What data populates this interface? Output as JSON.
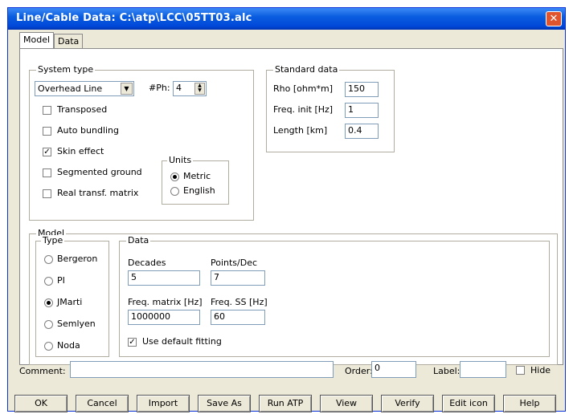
{
  "window": {
    "title": "Line/Cable Data: C:\\atp\\LCC\\05TT03.alc",
    "close_glyph": "✕"
  },
  "tabs": [
    {
      "label": "Model"
    },
    {
      "label": "Data"
    }
  ],
  "system_type": {
    "group_label": "System type",
    "type_value": "Overhead Line",
    "ph_label": "#Ph:",
    "ph_value": "4",
    "transposed_label": "Transposed",
    "transposed_checked": false,
    "auto_bundling_label": "Auto bundling",
    "auto_bundling_checked": false,
    "skin_effect_label": "Skin effect",
    "skin_effect_checked": true,
    "segmented_ground_label": "Segmented ground",
    "segmented_ground_checked": false,
    "real_transf_label": "Real transf. matrix",
    "real_transf_checked": false,
    "units": {
      "group_label": "Units",
      "metric_label": "Metric",
      "english_label": "English",
      "selected": "Metric"
    }
  },
  "standard_data": {
    "group_label": "Standard data",
    "rho_label": "Rho [ohm*m]",
    "rho_value": "150",
    "freq_init_label": "Freq. init [Hz]",
    "freq_init_value": "1",
    "length_label": "Length [km]",
    "length_value": "0.4"
  },
  "model": {
    "group_label": "Model",
    "type_group_label": "Type",
    "types": [
      "Bergeron",
      "PI",
      "JMarti",
      "Semlyen",
      "Noda"
    ],
    "selected_type": "JMarti",
    "data_group_label": "Data",
    "decades_label": "Decades",
    "decades_value": "5",
    "points_label": "Points/Dec",
    "points_value": "7",
    "freq_matrix_label": "Freq. matrix [Hz]",
    "freq_matrix_value": "1000000",
    "freq_ss_label": "Freq. SS [Hz]",
    "freq_ss_value": "60",
    "use_default_fitting_label": "Use default fitting",
    "use_default_fitting_checked": true
  },
  "footer": {
    "comment_label": "Comment:",
    "comment_value": "",
    "order_label": "Order:",
    "order_value": "0",
    "label_label": "Label:",
    "label_value": "",
    "hide_label": "Hide",
    "hide_checked": false
  },
  "buttons": {
    "ok": "OK",
    "cancel": "Cancel",
    "import": "Import",
    "save_as": "Save As",
    "run_atp": "Run ATP",
    "view": "View",
    "verify": "Verify",
    "edit_icon": "Edit icon",
    "help": "Help"
  }
}
